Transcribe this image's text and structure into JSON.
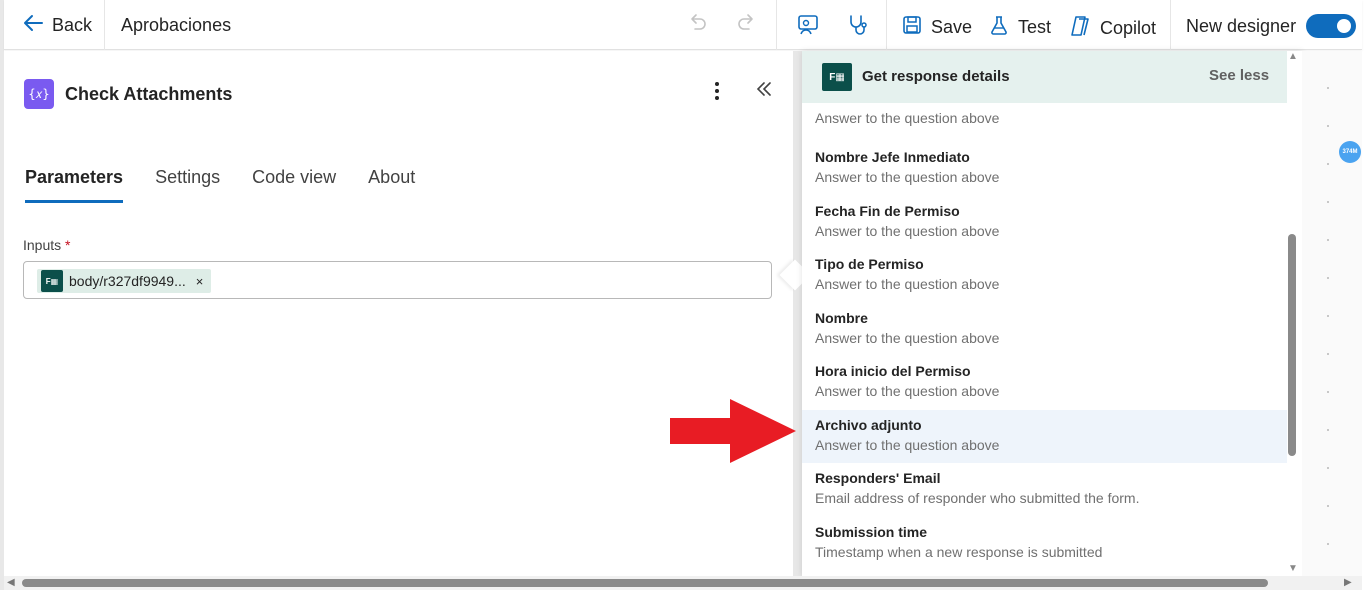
{
  "toolbar": {
    "back_label": "Back",
    "flow_title": "Aprobaciones",
    "save_label": "Save",
    "test_label": "Test",
    "copilot_label": "Copilot",
    "new_designer_label": "New designer",
    "new_designer_on": true
  },
  "action": {
    "title": "Check Attachments",
    "icon_glyph": "{𝑥}",
    "tabs": [
      {
        "label": "Parameters",
        "active": true
      },
      {
        "label": "Settings",
        "active": false
      },
      {
        "label": "Code view",
        "active": false
      },
      {
        "label": "About",
        "active": false
      }
    ],
    "inputs_label": "Inputs",
    "required_mark": "*",
    "token_label": "body/r327df9949...",
    "token_remove": "×"
  },
  "dropdown": {
    "header_title": "Get response details",
    "see_less_label": "See less",
    "first_desc": "Answer to the question above",
    "items": [
      {
        "name": "Nombre Jefe Inmediato",
        "desc": "Answer to the question above"
      },
      {
        "name": "Fecha Fin de Permiso",
        "desc": "Answer to the question above"
      },
      {
        "name": "Tipo de Permiso",
        "desc": "Answer to the question above"
      },
      {
        "name": "Nombre",
        "desc": "Answer to the question above"
      },
      {
        "name": "Hora inicio del Permiso",
        "desc": "Answer to the question above"
      },
      {
        "name": "Archivo adjunto",
        "desc": "Answer to the question above"
      },
      {
        "name": "Responders' Email",
        "desc": "Email address of responder who submitted the form."
      },
      {
        "name": "Submission time",
        "desc": "Timestamp when a new response is submitted"
      }
    ]
  },
  "canvas": {
    "badge_text": "374M"
  },
  "colors": {
    "accent": "#0f6cbd",
    "action_icon": "#7a5af0",
    "forms_icon": "#0b4f4a",
    "highlight_arrow": "#e81c24"
  }
}
